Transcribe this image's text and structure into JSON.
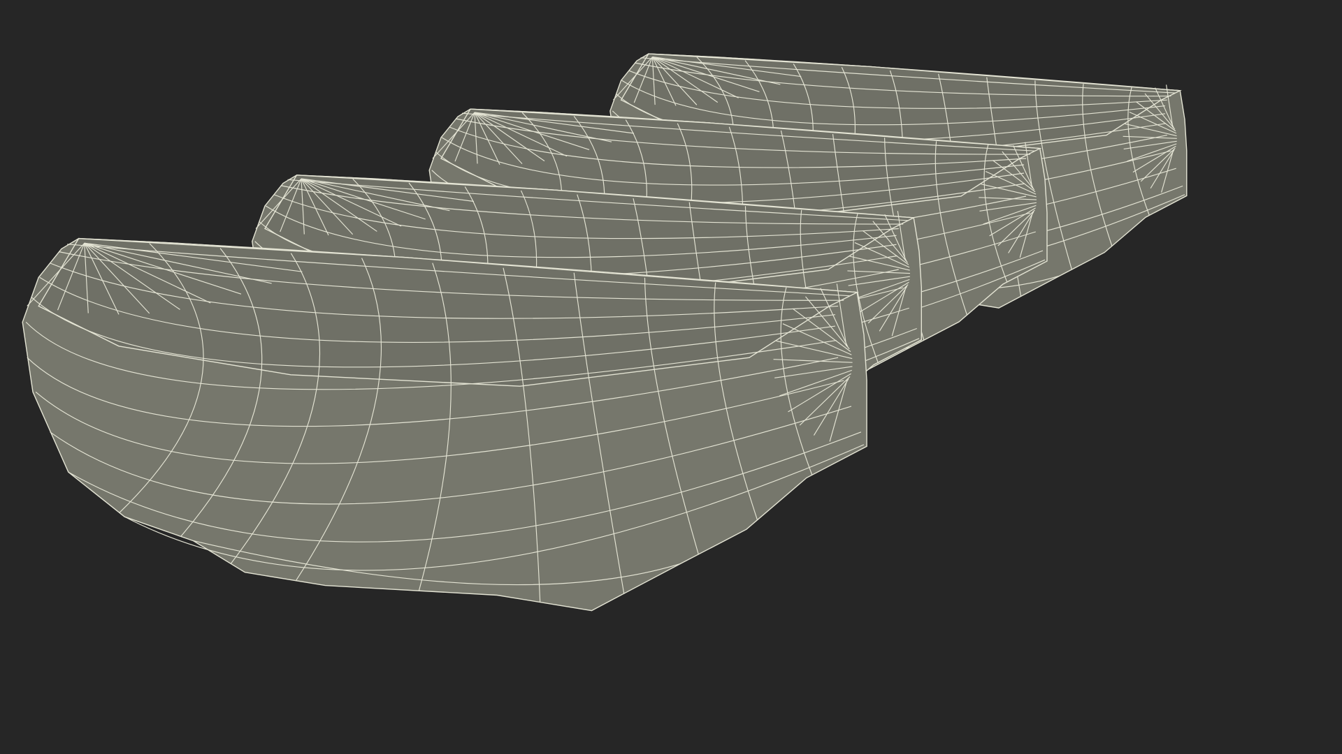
{
  "scene": {
    "subject": "wireframe-render",
    "object_count": 4,
    "colors": {
      "background": "#262626",
      "surface": "#76776c",
      "surface_shade": "#6f7066",
      "wire": "#e4e4d4"
    }
  }
}
